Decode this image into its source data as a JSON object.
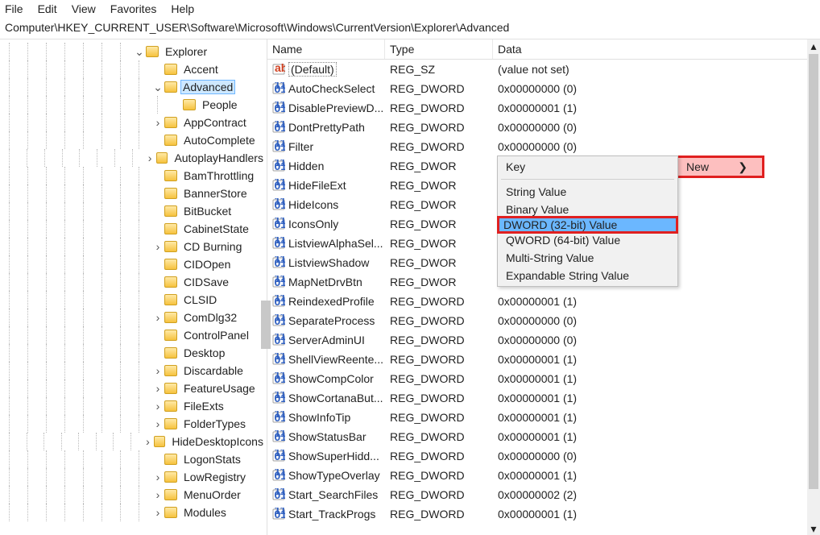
{
  "menubar": [
    "File",
    "Edit",
    "View",
    "Favorites",
    "Help"
  ],
  "address": "Computer\\HKEY_CURRENT_USER\\Software\\Microsoft\\Windows\\CurrentVersion\\Explorer\\Advanced",
  "columns": {
    "name": "Name",
    "type": "Type",
    "data": "Data"
  },
  "tree": {
    "selected": "Advanced",
    "top": "Explorer",
    "under_explorer": [
      "Accent"
    ],
    "advanced_child": "People",
    "siblings": [
      "AppContract",
      "AutoComplete",
      "AutoplayHandlers",
      "BamThrottling",
      "BannerStore",
      "BitBucket",
      "CabinetState",
      "CD Burning",
      "CIDOpen",
      "CIDSave",
      "CLSID",
      "ComDlg32",
      "ControlPanel",
      "Desktop",
      "Discardable",
      "FeatureUsage",
      "FileExts",
      "FolderTypes",
      "HideDesktopIcons",
      "LogonStats",
      "LowRegistry",
      "MenuOrder",
      "Modules"
    ],
    "expandable": [
      "AppContract",
      "AutoplayHandlers",
      "CD Burning",
      "ComDlg32",
      "Discardable",
      "FeatureUsage",
      "FileExts",
      "FolderTypes",
      "HideDesktopIcons",
      "LowRegistry",
      "MenuOrder",
      "Modules"
    ]
  },
  "values": [
    {
      "name": "(Default)",
      "type": "REG_SZ",
      "data": "(value not set)",
      "icon": "sz",
      "default": true
    },
    {
      "name": "AutoCheckSelect",
      "type": "REG_DWORD",
      "data": "0x00000000 (0)",
      "icon": "bin"
    },
    {
      "name": "DisablePreviewD...",
      "type": "REG_DWORD",
      "data": "0x00000001 (1)",
      "icon": "bin"
    },
    {
      "name": "DontPrettyPath",
      "type": "REG_DWORD",
      "data": "0x00000000 (0)",
      "icon": "bin"
    },
    {
      "name": "Filter",
      "type": "REG_DWORD",
      "data": "0x00000000 (0)",
      "icon": "bin"
    },
    {
      "name": "Hidden",
      "type": "REG_DWOR",
      "data": "",
      "icon": "bin"
    },
    {
      "name": "HideFileExt",
      "type": "REG_DWOR",
      "data": "",
      "icon": "bin"
    },
    {
      "name": "HideIcons",
      "type": "REG_DWOR",
      "data": "",
      "icon": "bin"
    },
    {
      "name": "IconsOnly",
      "type": "REG_DWOR",
      "data": "",
      "icon": "bin"
    },
    {
      "name": "ListviewAlphaSel...",
      "type": "REG_DWOR",
      "data": "",
      "icon": "bin"
    },
    {
      "name": "ListviewShadow",
      "type": "REG_DWOR",
      "data": "",
      "icon": "bin"
    },
    {
      "name": "MapNetDrvBtn",
      "type": "REG_DWOR",
      "data": "",
      "icon": "bin"
    },
    {
      "name": "ReindexedProfile",
      "type": "REG_DWORD",
      "data": "0x00000001 (1)",
      "icon": "bin"
    },
    {
      "name": "SeparateProcess",
      "type": "REG_DWORD",
      "data": "0x00000000 (0)",
      "icon": "bin"
    },
    {
      "name": "ServerAdminUI",
      "type": "REG_DWORD",
      "data": "0x00000000 (0)",
      "icon": "bin"
    },
    {
      "name": "ShellViewReente...",
      "type": "REG_DWORD",
      "data": "0x00000001 (1)",
      "icon": "bin"
    },
    {
      "name": "ShowCompColor",
      "type": "REG_DWORD",
      "data": "0x00000001 (1)",
      "icon": "bin"
    },
    {
      "name": "ShowCortanaBut...",
      "type": "REG_DWORD",
      "data": "0x00000001 (1)",
      "icon": "bin"
    },
    {
      "name": "ShowInfoTip",
      "type": "REG_DWORD",
      "data": "0x00000001 (1)",
      "icon": "bin"
    },
    {
      "name": "ShowStatusBar",
      "type": "REG_DWORD",
      "data": "0x00000001 (1)",
      "icon": "bin"
    },
    {
      "name": "ShowSuperHidd...",
      "type": "REG_DWORD",
      "data": "0x00000000 (0)",
      "icon": "bin"
    },
    {
      "name": "ShowTypeOverlay",
      "type": "REG_DWORD",
      "data": "0x00000001 (1)",
      "icon": "bin"
    },
    {
      "name": "Start_SearchFiles",
      "type": "REG_DWORD",
      "data": "0x00000002 (2)",
      "icon": "bin"
    },
    {
      "name": "Start_TrackProgs",
      "type": "REG_DWORD",
      "data": "0x00000001 (1)",
      "icon": "bin"
    }
  ],
  "context_new": {
    "label": "New",
    "arrow": "❯"
  },
  "submenu_items": [
    "Key",
    "String Value",
    "Binary Value",
    "DWORD (32-bit) Value",
    "QWORD (64-bit) Value",
    "Multi-String Value",
    "Expandable String Value"
  ],
  "submenu_highlight": 3
}
